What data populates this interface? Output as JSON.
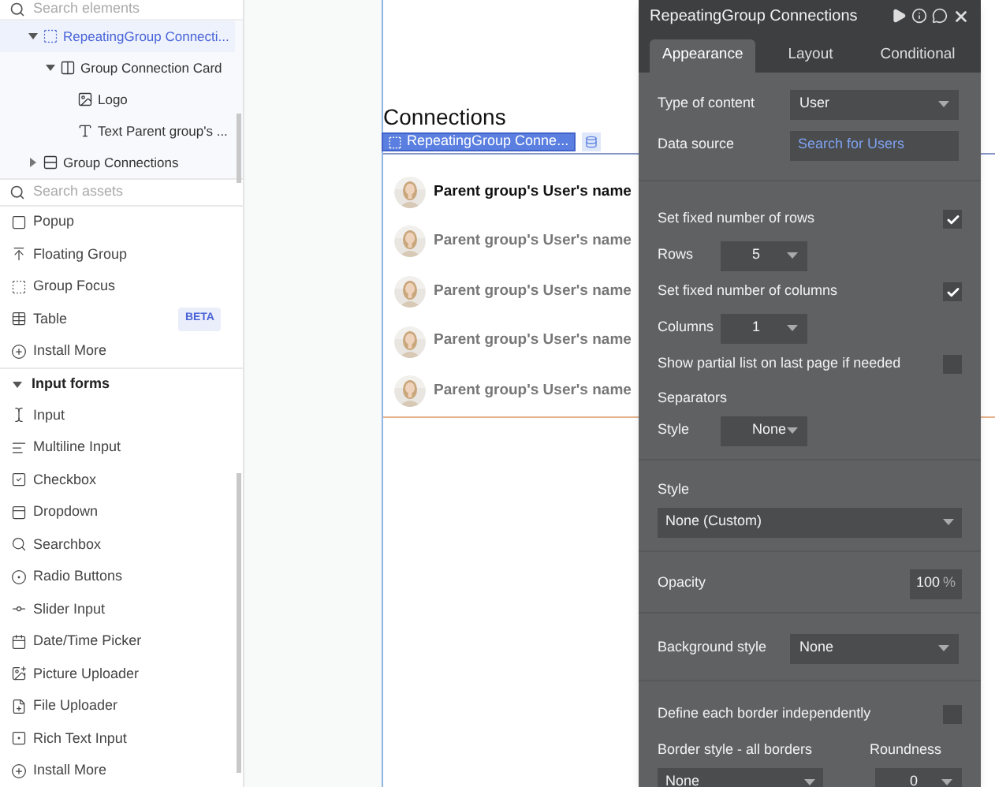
{
  "sidebar": {
    "search_elements": {
      "placeholder": "Search elements"
    },
    "tree": [
      {
        "label": "RepeatingGroup Connecti...",
        "selected": true,
        "expanded": true,
        "children": [
          {
            "label": "Group Connection Card",
            "selected": false,
            "expanded": true,
            "children": [
              {
                "label": "Logo",
                "selected": false
              },
              {
                "label": "Text Parent group's ...",
                "selected": false
              }
            ]
          }
        ]
      },
      {
        "label": "Group Connections",
        "selected": false,
        "expanded": false
      }
    ],
    "search_assets": {
      "placeholder": "Search assets"
    },
    "asset_groups": [
      {
        "items": [
          {
            "label": "Popup"
          },
          {
            "label": "Floating Group"
          },
          {
            "label": "Group Focus"
          },
          {
            "label": "Table",
            "badge": "BETA"
          },
          {
            "label": "Install More"
          }
        ]
      },
      {
        "title": "Input forms",
        "expanded": true,
        "items": [
          {
            "label": "Input"
          },
          {
            "label": "Multiline Input"
          },
          {
            "label": "Checkbox"
          },
          {
            "label": "Dropdown"
          },
          {
            "label": "Searchbox"
          },
          {
            "label": "Radio Buttons"
          },
          {
            "label": "Slider Input"
          },
          {
            "label": "Date/Time Picker"
          },
          {
            "label": "Picture Uploader"
          },
          {
            "label": "File Uploader"
          },
          {
            "label": "Rich Text Input"
          },
          {
            "label": "Install More"
          }
        ]
      }
    ]
  },
  "canvas": {
    "heading": "Connections",
    "element_label": "RepeatingGroup Conne...",
    "rows": [
      {
        "name": "Parent group's User's name",
        "selected": true
      },
      {
        "name": "Parent group's User's name",
        "selected": false
      },
      {
        "name": "Parent group's User's name",
        "selected": false
      },
      {
        "name": "Parent group's User's name",
        "selected": false
      },
      {
        "name": "Parent group's User's name",
        "selected": false
      }
    ]
  },
  "panel": {
    "title": "RepeatingGroup Connections",
    "tabs": [
      {
        "label": "Appearance",
        "selected": true
      },
      {
        "label": "Layout",
        "selected": false
      },
      {
        "label": "Conditional",
        "selected": false
      }
    ],
    "sections": [
      [
        {
          "kind": "select",
          "label": "Type of content",
          "value": "User"
        },
        {
          "kind": "link",
          "label": "Data source",
          "value": "Search for Users"
        }
      ],
      [
        {
          "kind": "checkbox",
          "label": "Set fixed number of rows",
          "checked": true
        },
        {
          "kind": "small-select",
          "label": "Rows",
          "value": "5"
        },
        {
          "kind": "checkbox",
          "label": "Set fixed number of columns",
          "checked": true
        },
        {
          "kind": "small-select",
          "label": "Columns",
          "value": "1"
        },
        {
          "kind": "checkbox",
          "label": "Show partial list on last page if needed",
          "checked": false
        },
        {
          "kind": "heading",
          "label": "Separators"
        },
        {
          "kind": "small-select",
          "label": "Style",
          "value": "None"
        }
      ],
      [
        {
          "kind": "heading",
          "label": "Style"
        },
        {
          "kind": "full-select",
          "value": "None (Custom)"
        }
      ],
      [
        {
          "kind": "percent",
          "label": "Opacity",
          "value": "100",
          "unit": "%"
        }
      ],
      [
        {
          "kind": "select",
          "label": "Background style",
          "value": "None"
        }
      ],
      [
        {
          "kind": "checkbox",
          "label": "Define each border independently",
          "checked": false
        },
        {
          "kind": "pair",
          "label": "Border style - all borders",
          "label2": "Roundness",
          "value": "None",
          "value2": "0"
        }
      ]
    ]
  }
}
